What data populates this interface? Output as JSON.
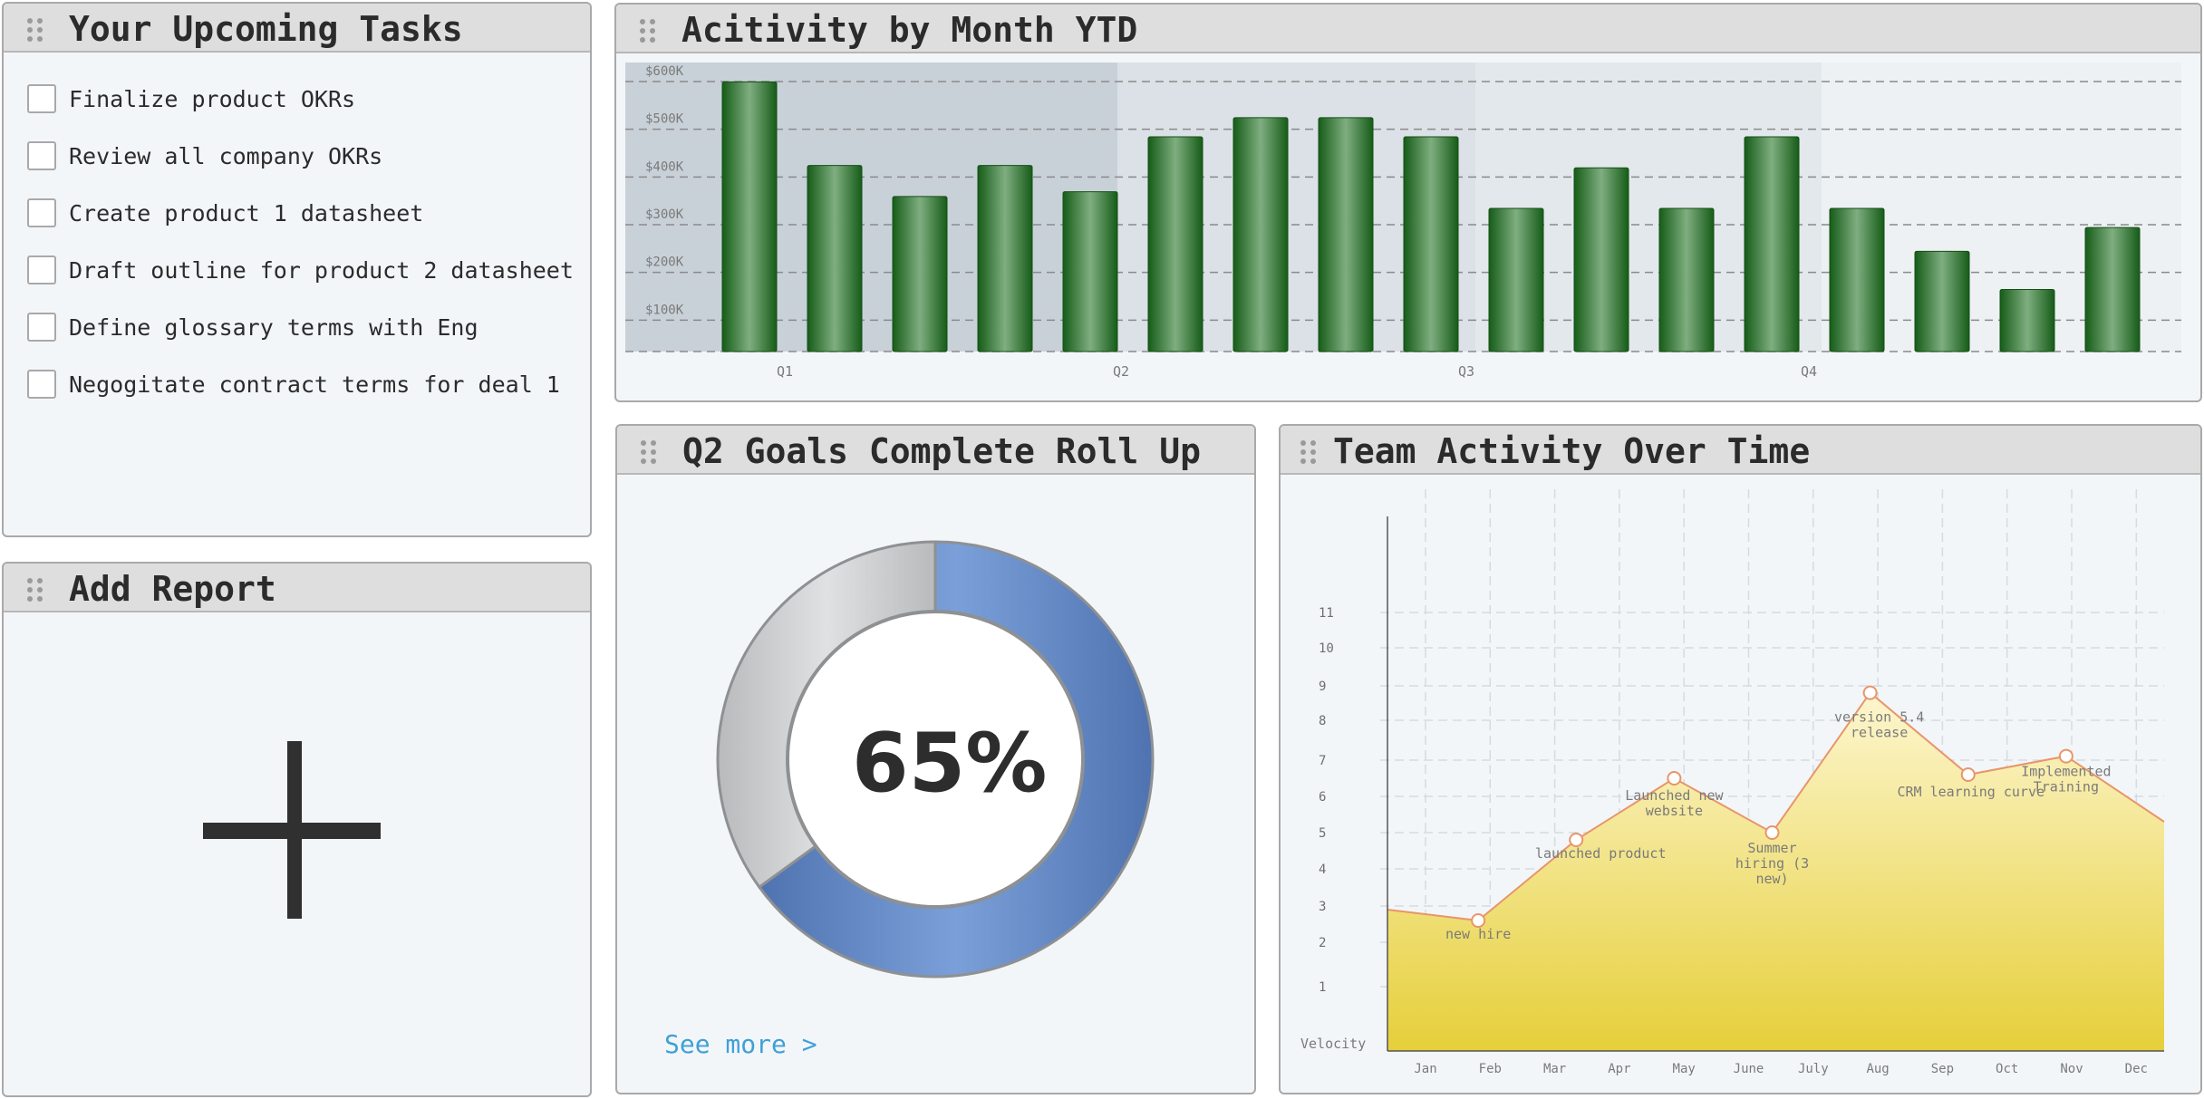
{
  "tasks_panel": {
    "title": "Your Upcoming Tasks",
    "items": [
      "Finalize product OKRs",
      "Review all company OKRs",
      "Create product 1 datasheet",
      "Draft outline for product 2 datasheet",
      "Define glossary terms with Eng",
      "Negogitate contract terms for deal 1"
    ]
  },
  "add_report_panel": {
    "title": "Add Report",
    "icon": "plus-icon"
  },
  "activity_panel": {
    "title": "Acitivity by Month YTD"
  },
  "goals_panel": {
    "title": "Q2 Goals Complete Roll Up",
    "percent_label": "65%",
    "link_label": "See more >"
  },
  "team_panel": {
    "title": "Team Activity Over Time"
  },
  "chart_data": [
    {
      "type": "bar",
      "title": "Acitivity by Month YTD",
      "y_tick_labels": [
        "$100K",
        "$200K",
        "$300K",
        "$400K",
        "$500K",
        "$600K"
      ],
      "ylim": [
        0,
        600
      ],
      "quarter_labels": [
        "Q1",
        "Q2",
        "Q3",
        "Q4"
      ],
      "values": [
        565,
        390,
        325,
        390,
        335,
        450,
        490,
        490,
        450,
        300,
        385,
        300,
        450,
        300,
        210,
        130,
        260
      ],
      "bar_color": "#1f7a24",
      "grid": true
    },
    {
      "type": "pie",
      "title": "Q2 Goals Complete Roll Up",
      "slices": [
        {
          "label": "complete",
          "value": 65,
          "color": "#5f86c4"
        },
        {
          "label": "remaining",
          "value": 35,
          "color": "#c8cacc"
        }
      ],
      "center_label": "65%"
    },
    {
      "type": "area",
      "title": "Team Activity Over Time",
      "ylabel": "Velocity",
      "y_ticks": [
        1,
        2,
        3,
        4,
        5,
        6,
        7,
        8,
        9,
        10,
        11
      ],
      "ylim": [
        0,
        12
      ],
      "x_tick_labels": [
        "Jan",
        "Feb",
        "Mar",
        "Apr",
        "May",
        "June",
        "July",
        "Aug",
        "Sep",
        "Oct",
        "Nov",
        "Dec"
      ],
      "points": [
        {
          "x": 0,
          "y": 2.9,
          "label": ""
        },
        {
          "x": 1.5,
          "y": 2.6,
          "label": "new hire"
        },
        {
          "x": 3,
          "y": 4.8,
          "label": "launched product"
        },
        {
          "x": 4.5,
          "y": 6.5,
          "label": "Launched new website"
        },
        {
          "x": 6,
          "y": 5.0,
          "label": "Summer hiring (3 new)"
        },
        {
          "x": 7.5,
          "y": 8.8,
          "label": "version 5.4 release"
        },
        {
          "x": 9,
          "y": 6.6,
          "label": "CRM learning curve"
        },
        {
          "x": 10.5,
          "y": 7.1,
          "label": "Implemented Training"
        },
        {
          "x": 12,
          "y": 5.3,
          "label": ""
        }
      ],
      "line_color": "#e8956a",
      "fill_top": "#fdf6cf",
      "fill_bottom": "#e6cf3a",
      "grid": true
    }
  ]
}
